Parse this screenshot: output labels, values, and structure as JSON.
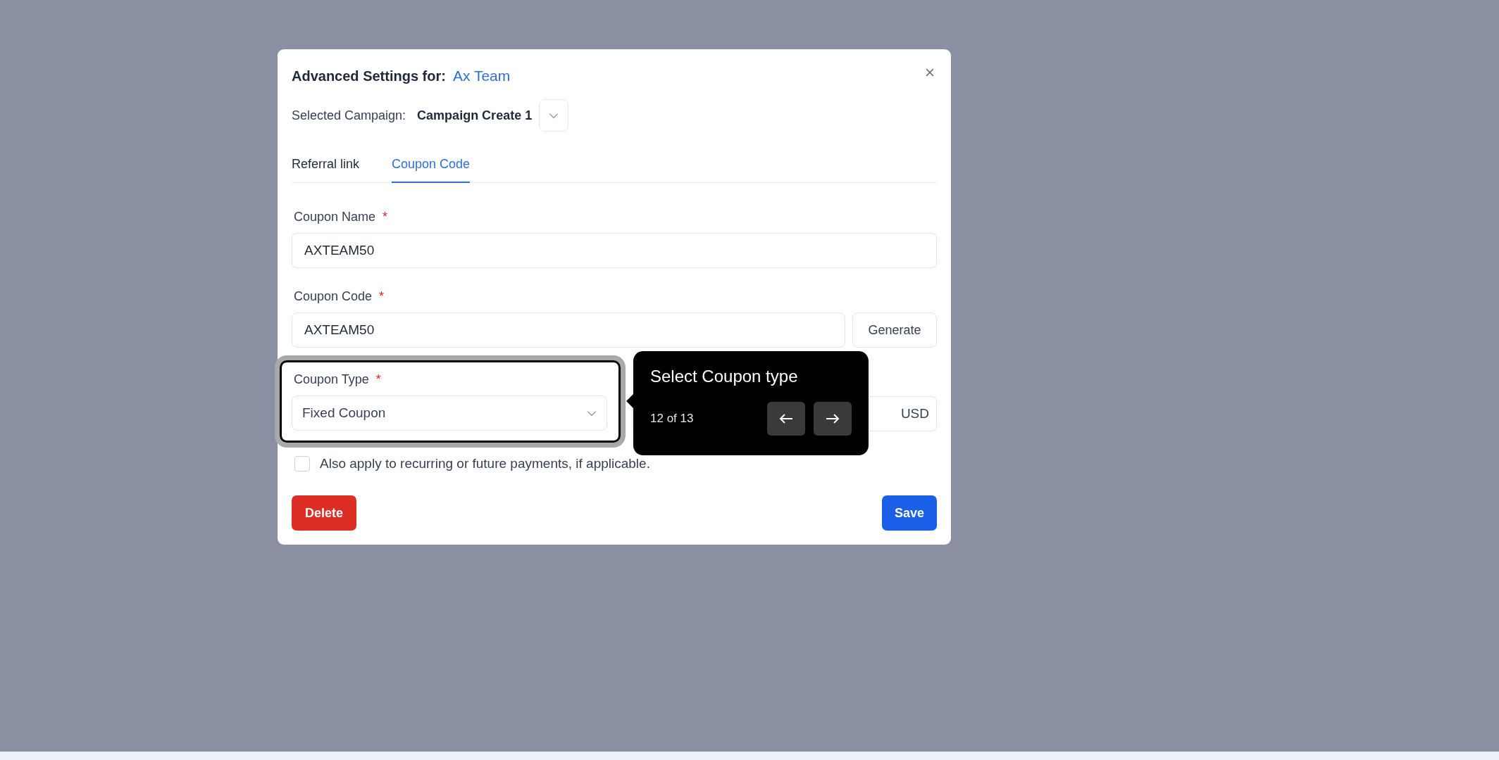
{
  "modal": {
    "title": "Advanced Settings for:",
    "team": "Ax Team",
    "campaign": {
      "label": "Selected Campaign:",
      "value": "Campaign Create 1"
    },
    "tabs": [
      {
        "label": "Referral link",
        "selected": false
      },
      {
        "label": "Coupon Code",
        "selected": true
      }
    ],
    "fields": [
      {
        "kind": "text",
        "label": "Coupon Name",
        "required_mark": "*",
        "value": "AXTEAM50"
      },
      {
        "kind": "text-button",
        "label": "Coupon Code",
        "required_mark": "*",
        "value": "AXTEAM50",
        "button": "Generate"
      }
    ],
    "coupon_type": {
      "label": "Coupon Type",
      "required_mark": "*",
      "value": "Fixed Coupon",
      "highlighted": true
    },
    "amount": {
      "suffix": "USD"
    },
    "checkbox": {
      "label": "Also apply to recurring or future payments, if applicable.",
      "checked": false
    },
    "delete_button": "Delete",
    "save_button": "Save"
  },
  "tour": {
    "title": "Select Coupon type",
    "progress": "12 of 13"
  }
}
